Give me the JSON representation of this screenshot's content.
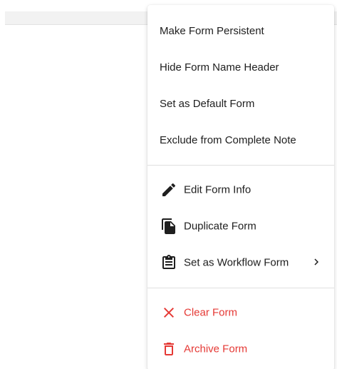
{
  "menu": {
    "options": [
      {
        "label": "Make Form Persistent"
      },
      {
        "label": "Hide Form Name Header"
      },
      {
        "label": "Set as Default Form"
      },
      {
        "label": "Exclude from Complete Note"
      }
    ],
    "actions": [
      {
        "label": "Edit Form Info",
        "icon": "pencil-icon"
      },
      {
        "label": "Duplicate Form",
        "icon": "copy-icon"
      },
      {
        "label": "Set as Workflow Form",
        "icon": "clipboard-icon",
        "submenu_icon": "chevron-right-icon"
      }
    ],
    "destructive": [
      {
        "label": "Clear Form",
        "icon": "close-icon"
      },
      {
        "label": "Archive Form",
        "icon": "trash-icon"
      }
    ]
  },
  "colors": {
    "text": "#202020",
    "danger": "#e53935",
    "divider": "#e0e0e0"
  }
}
